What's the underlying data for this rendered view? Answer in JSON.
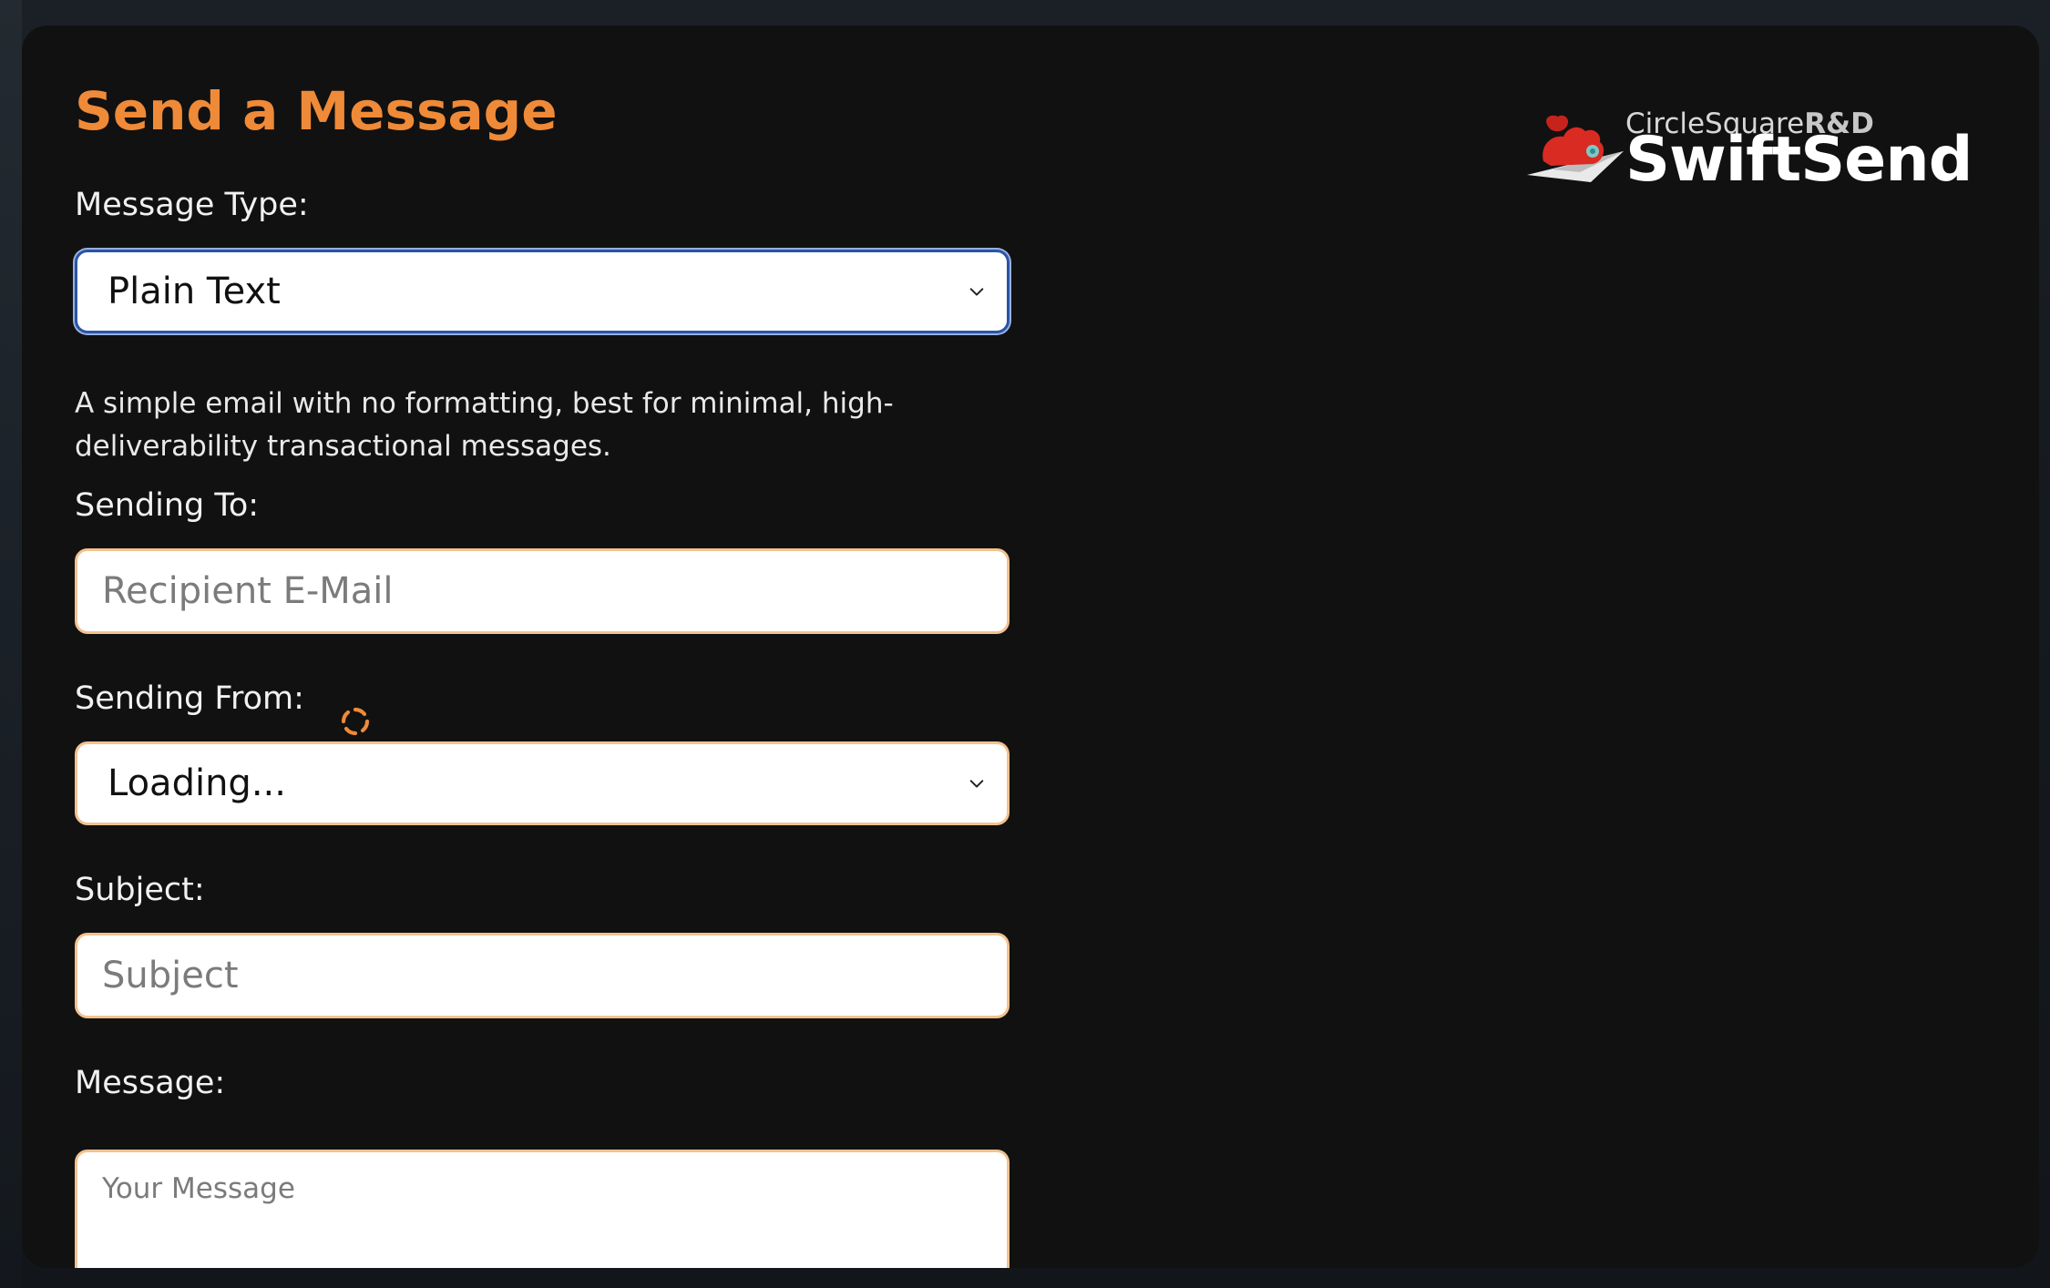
{
  "brand": {
    "top_name": "CircleSquare",
    "top_suffix": "R&D",
    "main_name": "SwiftSend",
    "icon_name": "squirrel-paper-plane-icon",
    "accent_color": "#ef8a38"
  },
  "form": {
    "title": "Send a Message",
    "message_type": {
      "label": "Message Type:",
      "selected": "Plain Text",
      "description": "A simple email with no formatting, best for minimal, high-deliverability transactional messages."
    },
    "sending_to": {
      "label": "Sending To:",
      "placeholder": "Recipient E-Mail",
      "value": ""
    },
    "sending_from": {
      "label": "Sending From:",
      "selected": "Loading...",
      "status_icon": "loading-spinner-icon"
    },
    "subject": {
      "label": "Subject:",
      "placeholder": "Subject",
      "value": ""
    },
    "message": {
      "label": "Message:",
      "placeholder": "Your Message",
      "value": ""
    }
  },
  "colors": {
    "panel_background": "#111111",
    "title_color": "#ef8a38",
    "field_border": "#f3c28f",
    "focus_border": "#2b54a4"
  }
}
